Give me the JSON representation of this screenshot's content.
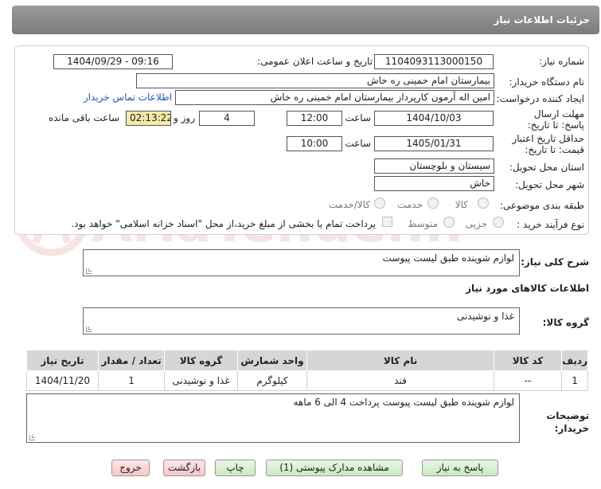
{
  "header": {
    "title": "جزئیات اطلاعات نیاز"
  },
  "form": {
    "need_number": {
      "label": "شماره نیاز:",
      "value": "1104093113000150"
    },
    "announce_datetime": {
      "label": "تاریخ و ساعت اعلان عمومی:",
      "value": "1404/09/29 - 09:16"
    },
    "buyer_org": {
      "label": "نام دستگاه خریدار:",
      "value": "بیمارستان امام خمینی  ره  خاش"
    },
    "requester": {
      "label": "ایجاد کننده درخواست:",
      "value": "امین اله آرمون کارپرداز بیمارستان امام خمینی  ره  خاش",
      "contact_link": "اطلاعات تماس خریدار"
    },
    "reply_deadline": {
      "label": "مهلت ارسال پاسخ: تا تاریخ:",
      "date": "1404/10/03",
      "time_label": "ساعت",
      "time": "12:00",
      "days": "4",
      "days_label": "روز و",
      "remaining": "02:13:22",
      "remaining_label": "ساعت باقی مانده"
    },
    "price_validity": {
      "label": "حداقل تاریخ اعتبار قیمت: تا تاریخ:",
      "date": "1405/01/31",
      "time_label": "ساعت",
      "time": "10:00"
    },
    "province": {
      "label": "استان محل تحویل:",
      "value": "سیستان و بلوچستان"
    },
    "city": {
      "label": "شهر محل تحویل:",
      "value": "خاش"
    },
    "category": {
      "label": "طبقه بندی موضوعی:",
      "options": [
        "کالا",
        "خدمت",
        "کالا/خدمت"
      ]
    },
    "purchase_type": {
      "label": "نوع فرآیند خرید :",
      "options": [
        "جزیی",
        "متوسط"
      ],
      "note": "پرداخت تمام یا بخشی از مبلغ خرید،از محل \"اسناد خزانه اسلامی\" خواهد بود."
    }
  },
  "description": {
    "label": "شرح کلی نیاز:",
    "value": "لوازم شوینده  طبق  لیست   پیوست"
  },
  "goods_info": {
    "title": "اطلاعات کالاهای مورد نیاز",
    "group_label": "گروه کالا:",
    "group_value": "غذا و نوشیدنی"
  },
  "table": {
    "headers": [
      "ردیف",
      "کد کالا",
      "نام کالا",
      "واحد شمارش",
      "گروه کالا",
      "تعداد / مقدار",
      "تاریخ نیاز"
    ],
    "rows": [
      [
        "1",
        "--",
        "قند",
        "کیلوگرم",
        "غذا و نوشیدنی",
        "1",
        "1404/11/20"
      ]
    ]
  },
  "buyer_notes": {
    "label": "توضیحات خریدار:",
    "value": "لوازم شوینده  طبق  لیست   پیوست   پرداخت  4 الی 6 ماهه"
  },
  "buttons": {
    "reply": "پاسخ به نیاز",
    "attachments": "مشاهده مدارک پیوستی (1)",
    "print": "چاپ",
    "back": "بازگشت",
    "exit": "خروج"
  },
  "watermark": {
    "text": "AriaTender.neT",
    "color": "#c0392b"
  }
}
